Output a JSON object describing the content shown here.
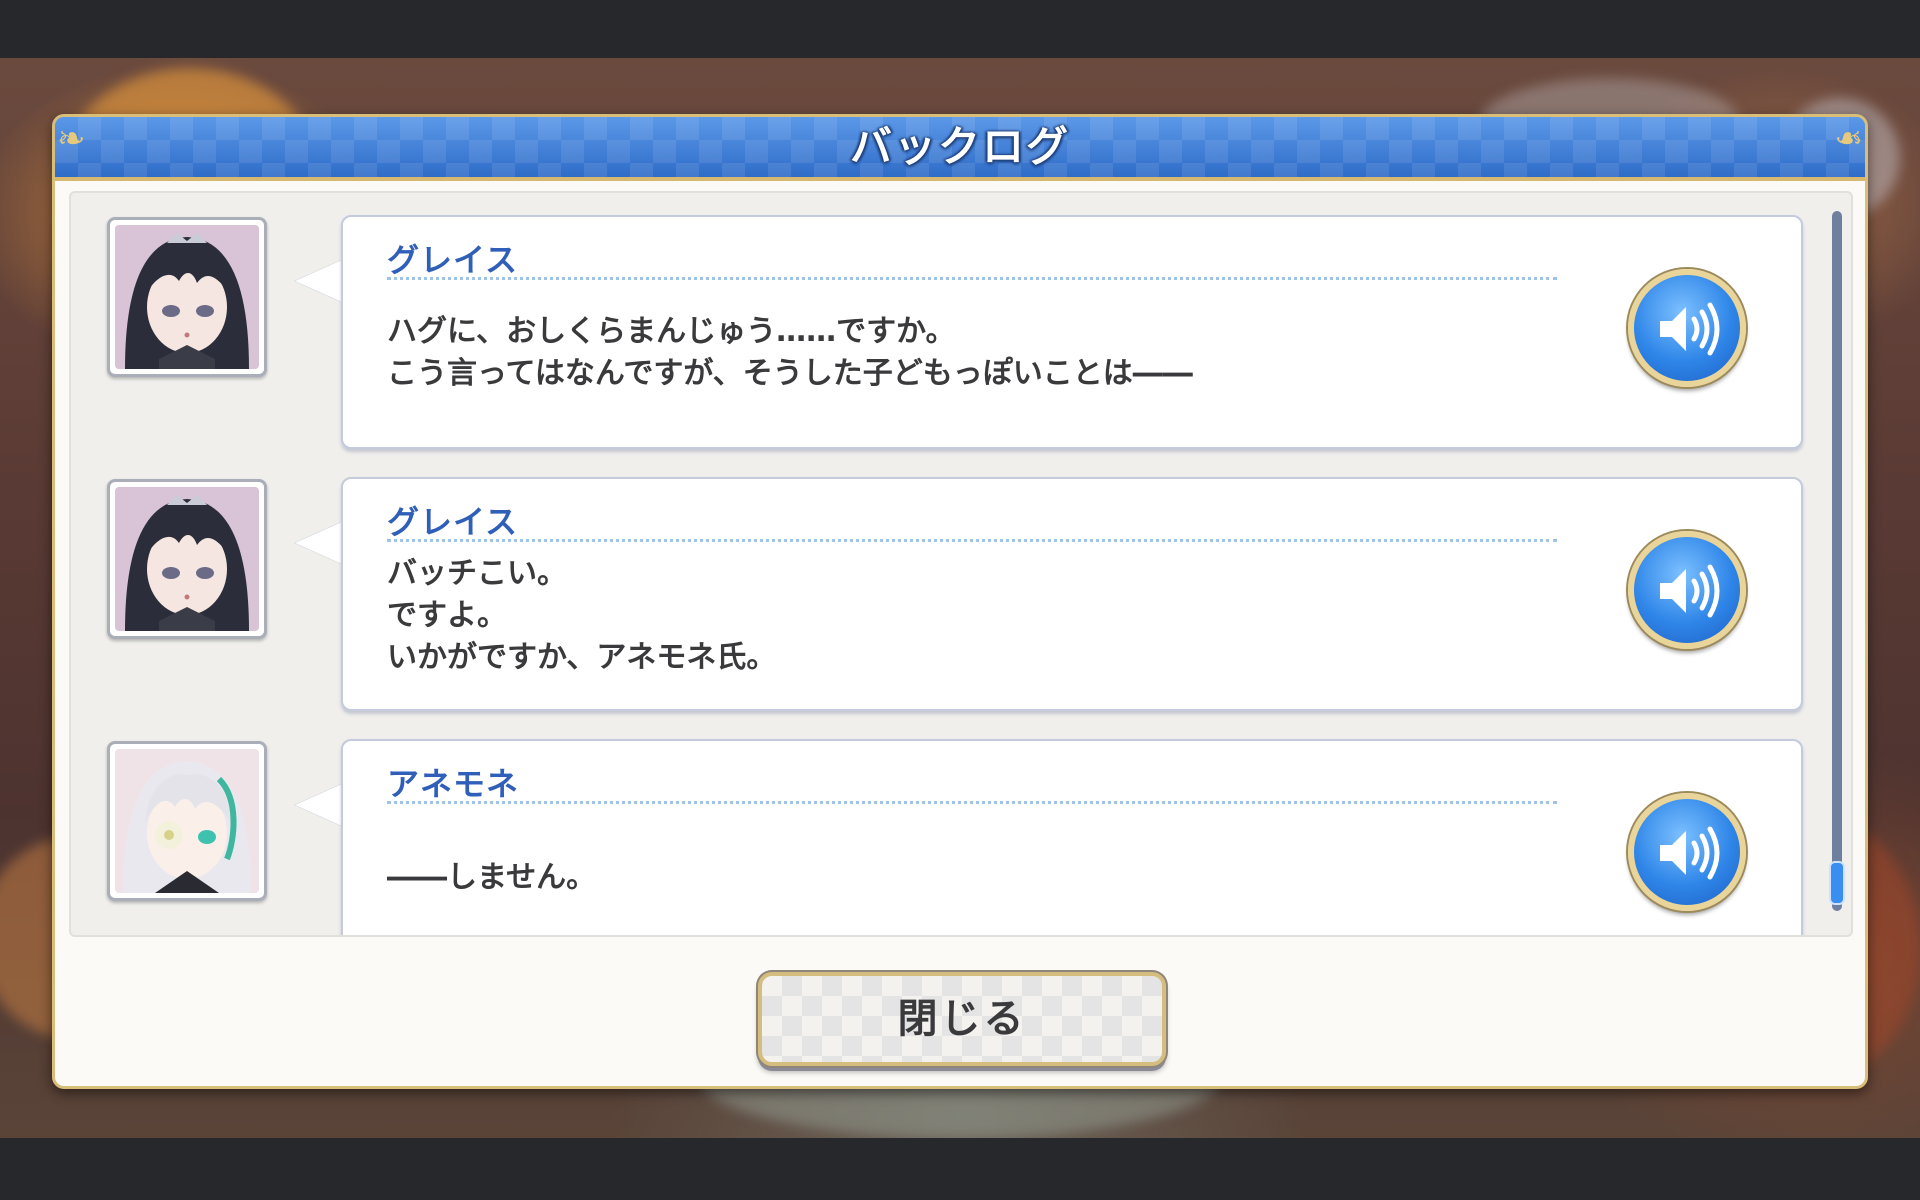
{
  "window": {
    "title": "バックログ",
    "accent": "#3f7fd6",
    "frame_gold": "#d9be7a"
  },
  "log": {
    "entries": [
      {
        "speaker": "グレイス",
        "lines": [
          "ハグに、おしくらまんじゅう……ですか。",
          "こう言ってはなんですが、そうした子どもっぽいことは――"
        ],
        "avatar": "grace-portrait",
        "voice_icon": "speaker-icon"
      },
      {
        "speaker": "グレイス",
        "lines": [
          "バッチこい。",
          "ですよ。",
          "いかがですか、アネモネ氏。"
        ],
        "avatar": "grace-portrait",
        "voice_icon": "speaker-icon"
      },
      {
        "speaker": "アネモネ",
        "lines": [
          "――しません。"
        ],
        "avatar": "anemone-portrait",
        "voice_icon": "speaker-icon"
      }
    ],
    "scroll_position": 0.95
  },
  "footer": {
    "close_label": "閉じる"
  }
}
